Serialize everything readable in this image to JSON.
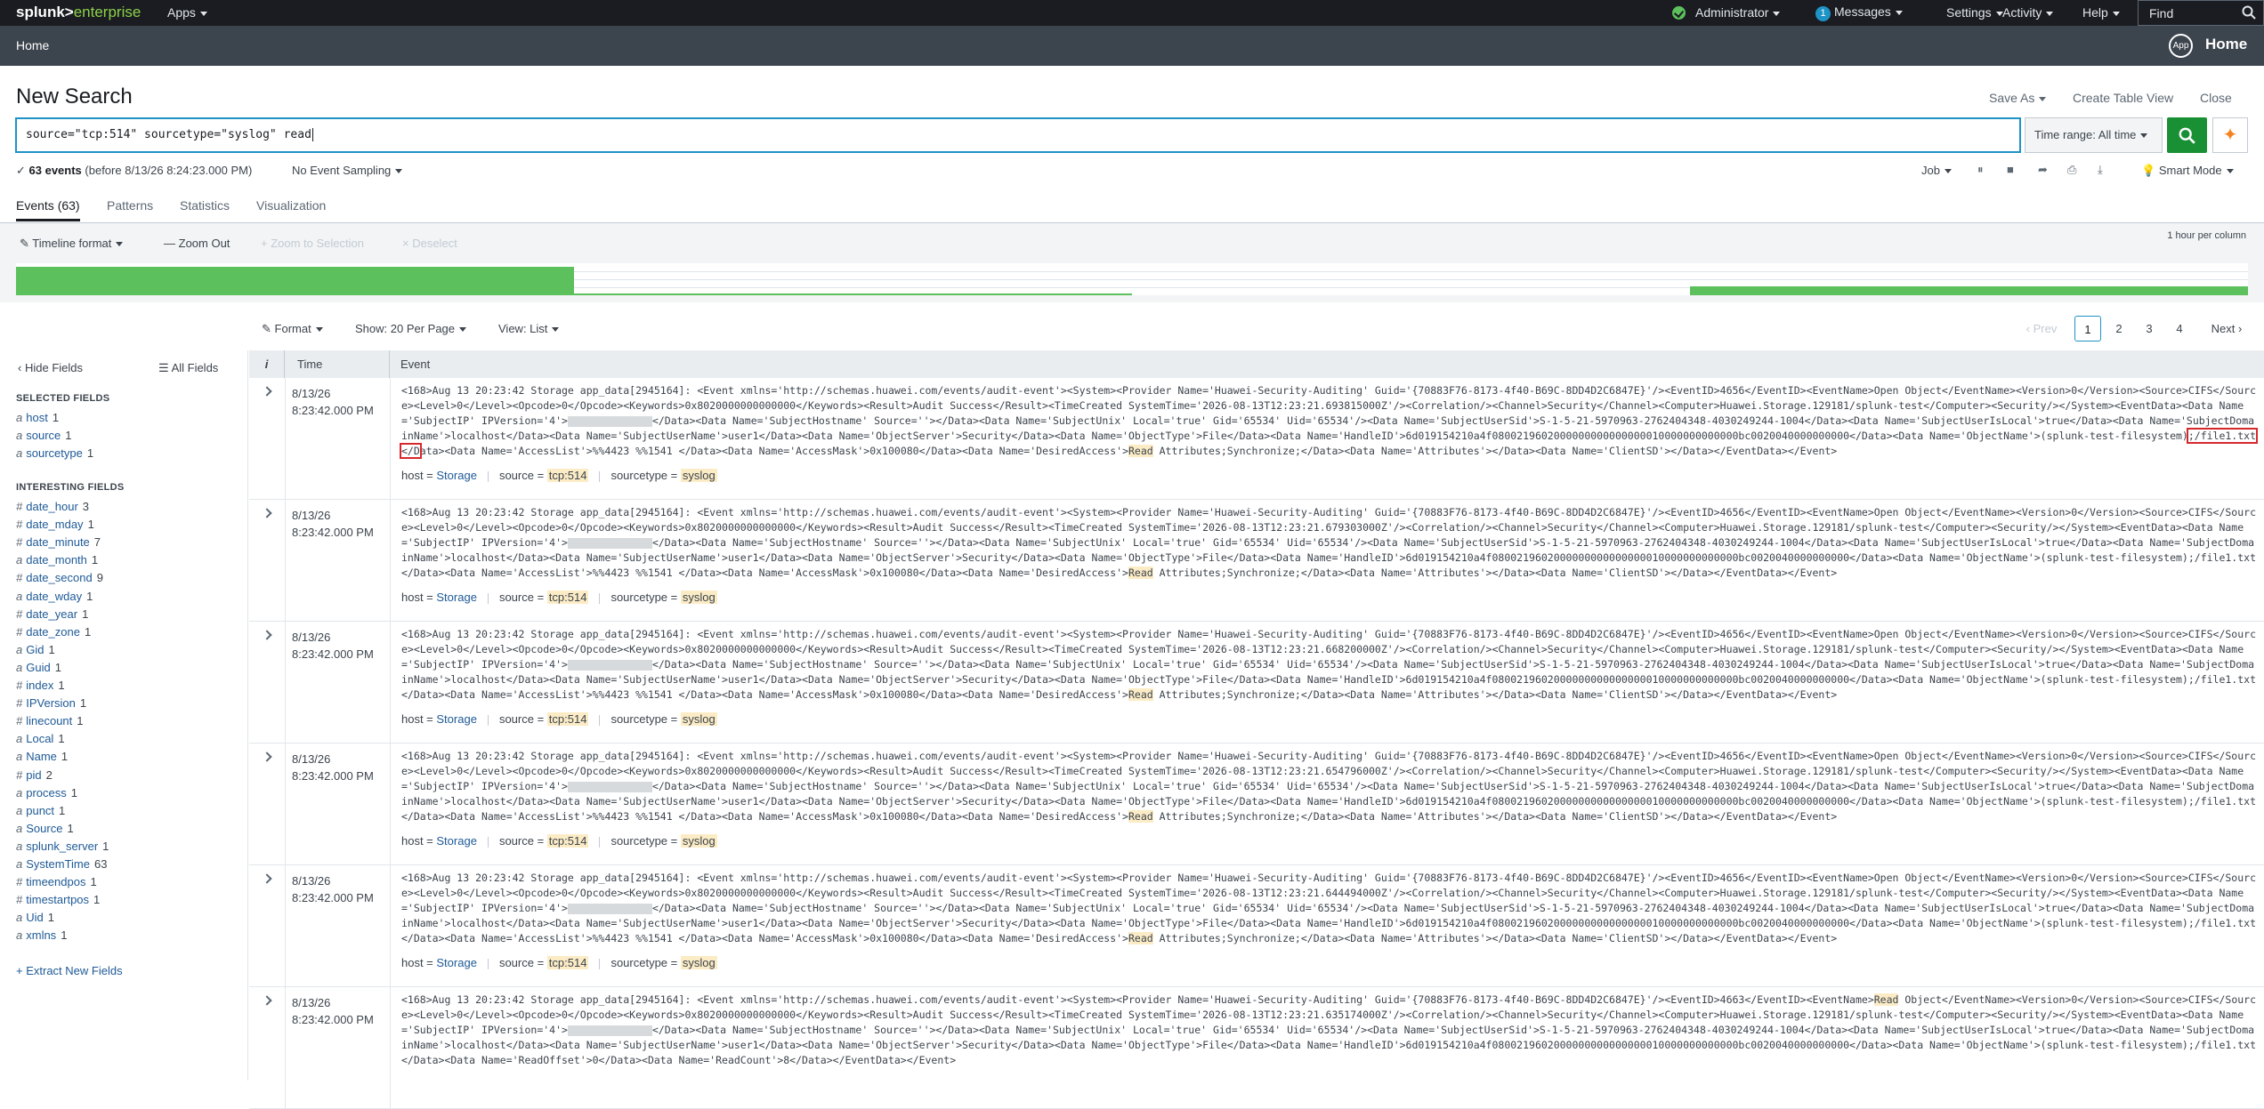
{
  "topbar": {
    "logo_bold": "splunk>",
    "logo_rest": "enterprise",
    "apps": "Apps",
    "admin": "Administrator",
    "messages_count": "1",
    "messages": "Messages",
    "settings": "Settings",
    "activity": "Activity",
    "help": "Help",
    "find_placeholder": "Find"
  },
  "appbar": {
    "home_link": "Home",
    "app_icon": "App",
    "app_title": "Home"
  },
  "header": {
    "title": "New Search",
    "save_as": "Save As",
    "create_table_view": "Create Table View",
    "close": "Close"
  },
  "search": {
    "query": "source=\"tcp:514\" sourcetype=\"syslog\" read",
    "time_range": "Time range: All time"
  },
  "status": {
    "events_count": "63 events",
    "events_detail": "(before 8/13/26 8:24:23.000 PM)",
    "sampling": "No Event Sampling",
    "job": "Job",
    "smart_mode": "Smart Mode"
  },
  "tabs": [
    {
      "label": "Events (63)",
      "active": true
    },
    {
      "label": "Patterns"
    },
    {
      "label": "Statistics"
    },
    {
      "label": "Visualization"
    }
  ],
  "timeline": {
    "format": "Timeline format",
    "zoom_out": "Zoom Out",
    "zoom_selection": "+ Zoom to Selection",
    "deselect": "× Deselect",
    "scale": "1 hour per column",
    "bars": [
      {
        "start": 0.0,
        "end": 0.25,
        "level": 1.0
      },
      {
        "start": 0.25,
        "end": 0.5,
        "level": 0.05
      },
      {
        "start": 0.75,
        "end": 1.0,
        "level": 0.3
      }
    ]
  },
  "results": {
    "format": "Format",
    "per_page": "Show: 20 Per Page",
    "view": "View: List",
    "prev": "‹ Prev",
    "pages": [
      "1",
      "2",
      "3",
      "4"
    ],
    "next": "Next ›"
  },
  "sidebar": {
    "hide_fields": "Hide Fields",
    "all_fields": "All Fields",
    "selected_heading": "SELECTED FIELDS",
    "selected": [
      {
        "type": "a",
        "name": "host",
        "count": "1"
      },
      {
        "type": "a",
        "name": "source",
        "count": "1"
      },
      {
        "type": "a",
        "name": "sourcetype",
        "count": "1"
      }
    ],
    "interesting_heading": "INTERESTING FIELDS",
    "interesting": [
      {
        "type": "#",
        "name": "date_hour",
        "count": "3"
      },
      {
        "type": "#",
        "name": "date_mday",
        "count": "1"
      },
      {
        "type": "#",
        "name": "date_minute",
        "count": "7"
      },
      {
        "type": "a",
        "name": "date_month",
        "count": "1"
      },
      {
        "type": "#",
        "name": "date_second",
        "count": "9"
      },
      {
        "type": "a",
        "name": "date_wday",
        "count": "1"
      },
      {
        "type": "#",
        "name": "date_year",
        "count": "1"
      },
      {
        "type": "#",
        "name": "date_zone",
        "count": "1"
      },
      {
        "type": "a",
        "name": "Gid",
        "count": "1"
      },
      {
        "type": "a",
        "name": "Guid",
        "count": "1"
      },
      {
        "type": "#",
        "name": "index",
        "count": "1"
      },
      {
        "type": "#",
        "name": "IPVersion",
        "count": "1"
      },
      {
        "type": "#",
        "name": "linecount",
        "count": "1"
      },
      {
        "type": "a",
        "name": "Local",
        "count": "1"
      },
      {
        "type": "a",
        "name": "Name",
        "count": "1"
      },
      {
        "type": "#",
        "name": "pid",
        "count": "2"
      },
      {
        "type": "a",
        "name": "process",
        "count": "1"
      },
      {
        "type": "a",
        "name": "punct",
        "count": "1"
      },
      {
        "type": "a",
        "name": "Source",
        "count": "1"
      },
      {
        "type": "a",
        "name": "splunk_server",
        "count": "1"
      },
      {
        "type": "a",
        "name": "SystemTime",
        "count": "63"
      },
      {
        "type": "#",
        "name": "timeendpos",
        "count": "1"
      },
      {
        "type": "#",
        "name": "timestartpos",
        "count": "1"
      },
      {
        "type": "a",
        "name": "Uid",
        "count": "1"
      },
      {
        "type": "a",
        "name": "xmlns",
        "count": "1"
      }
    ],
    "extract": "+ Extract New Fields"
  },
  "table": {
    "col_i": "i",
    "col_time": "Time",
    "col_event": "Event"
  },
  "events": [
    {
      "date": "8/13/26",
      "time": "8:23:42.000 PM",
      "p1": "<168>Aug 13 20:23:42 Storage app_data[2945164]: <Event xmlns='http://schemas.huawei.com/events/audit-event'><System><Provider Name='Huawei-Security-Auditing' Guid='{70883F76-8173-4f40-B69C-8DD4D2C6847E}'/><EventID>4656</EventID><EventName>Open Object</EventName><Version>0</Version><Source>CIFS</Source><Level>0</Level><Opcode>0</Opcode><Keywords>0x8020000000000000</Keywords><Result>Audit Success</Result><TimeCreated SystemTime='2026-08-13T12:23:21.693815000Z'/><Correlation/><Channel>Security</Channel><Computer>Huawei.Storage.129181/splunk-test</Computer><Security/></System><EventData><Data Name='SubjectIP' IPVersion='4'>",
      "p2": "</Data><Data Name='SubjectHostname' Source=''></Data><Data Name='SubjectUnix' Local='true' Gid='65534' Uid='65534'/><Data Name='SubjectUserSid'>S-1-5-21-5970963-2762404348-4030249244-1004</Data><Data Name='SubjectUserIsLocal'>true</Data><Data Name='SubjectDomainName'>localhost</Data><Data Name='SubjectUserName'>user1</Data><Data Name='ObjectServer'>Security</Data><Data Name='ObjectType'>File</Data><Data Name='HandleID'>6d019154210a4f0800219602000000000000000010000000000000bc0020040000000000</Data><Data Name='ObjectName'>(splunk-test-filesystem)",
      "boxed": ";/file1.txt</D",
      "p3": "ata><Data Name='AccessList'>%%4423 %%1541 </Data><Data Name='AccessMask'>0x100080</Data><Data Name='DesiredAccess'>",
      "hl": "Read",
      "p4": " Attributes;Synchronize;</Data><Data Name='Attributes'></Data><Data Name='ClientSD'></Data></EventData></Event>",
      "host": "Storage",
      "source": "tcp:514",
      "sourcetype": "syslog"
    },
    {
      "date": "8/13/26",
      "time": "8:23:42.000 PM",
      "p1": "<168>Aug 13 20:23:42 Storage app_data[2945164]: <Event xmlns='http://schemas.huawei.com/events/audit-event'><System><Provider Name='Huawei-Security-Auditing' Guid='{70883F76-8173-4f40-B69C-8DD4D2C6847E}'/><EventID>4656</EventID><EventName>Open Object</EventName><Version>0</Version><Source>CIFS</Source><Level>0</Level><Opcode>0</Opcode><Keywords>0x8020000000000000</Keywords><Result>Audit Success</Result><TimeCreated SystemTime='2026-08-13T12:23:21.679303000Z'/><Correlation/><Channel>Security</Channel><Computer>Huawei.Storage.129181/splunk-test</Computer><Security/></System><EventData><Data Name='SubjectIP' IPVersion='4'>",
      "p2": "</Data><Data Name='SubjectHostname' Source=''></Data><Data Name='SubjectUnix' Local='true' Gid='65534' Uid='65534'/><Data Name='SubjectUserSid'>S-1-5-21-5970963-2762404348-4030249244-1004</Data><Data Name='SubjectUserIsLocal'>true</Data><Data Name='SubjectDomainName'>localhost</Data><Data Name='SubjectUserName'>user1</Data><Data Name='ObjectServer'>Security</Data><Data Name='ObjectType'>File</Data><Data Name='HandleID'>6d019154210a4f0800219602000000000000000010000000000000bc0020040000000000</Data><Data Name='ObjectName'>(splunk-test-filesystem)",
      "boxed": "",
      "p3": ";/file1.txt</Data><Data Name='AccessList'>%%4423 %%1541 </Data><Data Name='AccessMask'>0x100080</Data><Data Name='DesiredAccess'>",
      "hl": "Read",
      "p4": " Attributes;Synchronize;</Data><Data Name='Attributes'></Data><Data Name='ClientSD'></Data></EventData></Event>",
      "host": "Storage",
      "source": "tcp:514",
      "sourcetype": "syslog"
    },
    {
      "date": "8/13/26",
      "time": "8:23:42.000 PM",
      "p1": "<168>Aug 13 20:23:42 Storage app_data[2945164]: <Event xmlns='http://schemas.huawei.com/events/audit-event'><System><Provider Name='Huawei-Security-Auditing' Guid='{70883F76-8173-4f40-B69C-8DD4D2C6847E}'/><EventID>4656</EventID><EventName>Open Object</EventName><Version>0</Version><Source>CIFS</Source><Level>0</Level><Opcode>0</Opcode><Keywords>0x8020000000000000</Keywords><Result>Audit Success</Result><TimeCreated SystemTime='2026-08-13T12:23:21.668200000Z'/><Correlation/><Channel>Security</Channel><Computer>Huawei.Storage.129181/splunk-test</Computer><Security/></System><EventData><Data Name='SubjectIP' IPVersion='4'>",
      "p2": "</Data><Data Name='SubjectHostname' Source=''></Data><Data Name='SubjectUnix' Local='true' Gid='65534' Uid='65534'/><Data Name='SubjectUserSid'>S-1-5-21-5970963-2762404348-4030249244-1004</Data><Data Name='SubjectUserIsLocal'>true</Data><Data Name='SubjectDomainName'>localhost</Data><Data Name='SubjectUserName'>user1</Data><Data Name='ObjectServer'>Security</Data><Data Name='ObjectType'>File</Data><Data Name='HandleID'>6d019154210a4f0800219602000000000000000010000000000000bc0020040000000000</Data><Data Name='ObjectName'>(splunk-test-filesystem)",
      "boxed": "",
      "p3": ";/file1.txt</Data><Data Name='AccessList'>%%4423 %%1541 </Data><Data Name='AccessMask'>0x100080</Data><Data Name='DesiredAccess'>",
      "hl": "Read",
      "p4": " Attributes;Synchronize;</Data><Data Name='Attributes'></Data><Data Name='ClientSD'></Data></EventData></Event>",
      "host": "Storage",
      "source": "tcp:514",
      "sourcetype": "syslog"
    },
    {
      "date": "8/13/26",
      "time": "8:23:42.000 PM",
      "p1": "<168>Aug 13 20:23:42 Storage app_data[2945164]: <Event xmlns='http://schemas.huawei.com/events/audit-event'><System><Provider Name='Huawei-Security-Auditing' Guid='{70883F76-8173-4f40-B69C-8DD4D2C6847E}'/><EventID>4656</EventID><EventName>Open Object</EventName><Version>0</Version><Source>CIFS</Source><Level>0</Level><Opcode>0</Opcode><Keywords>0x8020000000000000</Keywords><Result>Audit Success</Result><TimeCreated SystemTime='2026-08-13T12:23:21.654796000Z'/><Correlation/><Channel>Security</Channel><Computer>Huawei.Storage.129181/splunk-test</Computer><Security/></System><EventData><Data Name='SubjectIP' IPVersion='4'>",
      "p2": "</Data><Data Name='SubjectHostname' Source=''></Data><Data Name='SubjectUnix' Local='true' Gid='65534' Uid='65534'/><Data Name='SubjectUserSid'>S-1-5-21-5970963-2762404348-4030249244-1004</Data><Data Name='SubjectUserIsLocal'>true</Data><Data Name='SubjectDomainName'>localhost</Data><Data Name='SubjectUserName'>user1</Data><Data Name='ObjectServer'>Security</Data><Data Name='ObjectType'>File</Data><Data Name='HandleID'>6d019154210a4f0800219602000000000000000010000000000000bc0020040000000000</Data><Data Name='ObjectName'>(splunk-test-filesystem)",
      "boxed": "",
      "p3": ";/file1.txt</Data><Data Name='AccessList'>%%4423 %%1541 </Data><Data Name='AccessMask'>0x100080</Data><Data Name='DesiredAccess'>",
      "hl": "Read",
      "p4": " Attributes;Synchronize;</Data><Data Name='Attributes'></Data><Data Name='ClientSD'></Data></EventData></Event>",
      "host": "Storage",
      "source": "tcp:514",
      "sourcetype": "syslog"
    },
    {
      "date": "8/13/26",
      "time": "8:23:42.000 PM",
      "p1": "<168>Aug 13 20:23:42 Storage app_data[2945164]: <Event xmlns='http://schemas.huawei.com/events/audit-event'><System><Provider Name='Huawei-Security-Auditing' Guid='{70883F76-8173-4f40-B69C-8DD4D2C6847E}'/><EventID>4656</EventID><EventName>Open Object</EventName><Version>0</Version><Source>CIFS</Source><Level>0</Level><Opcode>0</Opcode><Keywords>0x8020000000000000</Keywords><Result>Audit Success</Result><TimeCreated SystemTime='2026-08-13T12:23:21.644494000Z'/><Correlation/><Channel>Security</Channel><Computer>Huawei.Storage.129181/splunk-test</Computer><Security/></System><EventData><Data Name='SubjectIP' IPVersion='4'>",
      "p2": "</Data><Data Name='SubjectHostname' Source=''></Data><Data Name='SubjectUnix' Local='true' Gid='65534' Uid='65534'/><Data Name='SubjectUserSid'>S-1-5-21-5970963-2762404348-4030249244-1004</Data><Data Name='SubjectUserIsLocal'>true</Data><Data Name='SubjectDomainName'>localhost</Data><Data Name='SubjectUserName'>user1</Data><Data Name='ObjectServer'>Security</Data><Data Name='ObjectType'>File</Data><Data Name='HandleID'>6d019154210a4f0800219602000000000000000010000000000000bc0020040000000000</Data><Data Name='ObjectName'>(splunk-test-filesystem)",
      "boxed": "",
      "p3": ";/file1.txt</Data><Data Name='AccessList'>%%4423 %%1541 </Data><Data Name='AccessMask'>0x100080</Data><Data Name='DesiredAccess'>",
      "hl": "Read",
      "p4": " Attributes;Synchronize;</Data><Data Name='Attributes'></Data><Data Name='ClientSD'></Data></EventData></Event>",
      "host": "Storage",
      "source": "tcp:514",
      "sourcetype": "syslog"
    },
    {
      "date": "8/13/26",
      "time": "8:23:42.000 PM",
      "p1": "<168>Aug 13 20:23:42 Storage app_data[2945164]: <Event xmlns='http://schemas.huawei.com/events/audit-event'><System><Provider Name='Huawei-Security-Auditing' Guid='{70883F76-8173-4f40-B69C-8DD4D2C6847E}'/><EventID>4663</EventID><EventName>",
      "hl0": "Read",
      "p1b": " Object</EventName><Version>0</Version><Source>CIFS</Source><Level>0</Level><Opcode>0</Opcode><Keywords>0x8020000000000000</Keywords><Result>Audit Success</Result><TimeCreated SystemTime='2026-08-13T12:23:21.635174000Z'/><Correlation/><Channel>Security</Channel><Computer>Huawei.Storage.129181/splunk-test</Computer><Security/></System><EventData><Data Name='SubjectIP' IPVersion='4'>",
      "p2": "</Data><Data Name='SubjectHostname' Source=''></Data><Data Name='SubjectUnix' Local='true' Gid='65534' Uid='65534'/><Data Name='SubjectUserSid'>S-1-5-21-5970963-2762404348-4030249244-1004</Data><Data Name='SubjectUserIsLocal'>true</Data><Data Name='SubjectDomainName'>localhost</Data><Data Name='SubjectUserName'>user1</Data><Data Name='ObjectServer'>Security</Data><Data Name='ObjectType'>File</Data><Data Name='HandleID'>6d019154210a4f0800219602000000000000000010000000000000bc0020040000000000</Data><Data Name='ObjectName'>(splunk-test-filesystem)",
      "boxed": "",
      "p3": ";/file1.txt</Data><Data Name='ReadOffset'>0</Data><Data Name='ReadCount'>8</Data></EventData></Event>",
      "hl": "",
      "p4": "",
      "host": "",
      "source": "",
      "sourcetype": ""
    }
  ]
}
